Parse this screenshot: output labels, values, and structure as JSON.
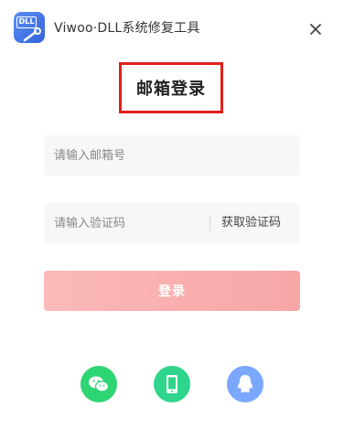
{
  "window": {
    "title": "Viwoo·DLL系统修复工具",
    "logo_text": "DLL"
  },
  "login": {
    "heading": "邮箱登录",
    "email_placeholder": "请输入邮箱号",
    "code_placeholder": "请输入验证码",
    "get_code_label": "获取验证码",
    "submit_label": "登录"
  },
  "social": {
    "icons": [
      "wechat-icon",
      "phone-icon",
      "qq-icon"
    ]
  },
  "colors": {
    "accent_red": "#e0211b",
    "button": "#f8a6a6",
    "wechat": "#2ed573",
    "phone": "#2ed58a",
    "qq": "#7aa8ff"
  }
}
